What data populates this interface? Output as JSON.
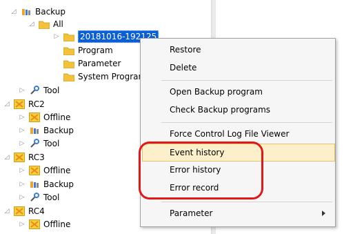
{
  "tree": {
    "backup_label": "Backup",
    "all_label": "All",
    "selected_item": "20181016-192125",
    "program_label": "Program",
    "parameter_label": "Parameter",
    "system_program_label": "System Program",
    "tool_label": "Tool",
    "rc2": {
      "label": "RC2",
      "offline": "Offline",
      "backup": "Backup",
      "tool": "Tool"
    },
    "rc3": {
      "label": "RC3",
      "offline": "Offline",
      "backup": "Backup",
      "tool": "Tool"
    },
    "rc4": {
      "label": "RC4",
      "offline": "Offline"
    }
  },
  "menu": {
    "items": [
      {
        "label": "Restore"
      },
      {
        "label": "Delete"
      },
      {
        "label": "Open Backup program"
      },
      {
        "label": "Check Backup programs"
      },
      {
        "label": "Force Control Log File Viewer"
      },
      {
        "label": "Event history",
        "highlighted": true
      },
      {
        "label": "Error history"
      },
      {
        "label": "Error record"
      },
      {
        "label": "Parameter",
        "has_submenu": true
      }
    ]
  },
  "icons": {
    "folder": "folder-icon",
    "backup": "backup-icon",
    "tool": "tool-icon",
    "controller": "controller-icon"
  },
  "colors": {
    "selection": "#0b5fd6",
    "highlight_bg": "#fbf0c9",
    "annotation": "#e01818",
    "folder": "#f2c23d"
  }
}
